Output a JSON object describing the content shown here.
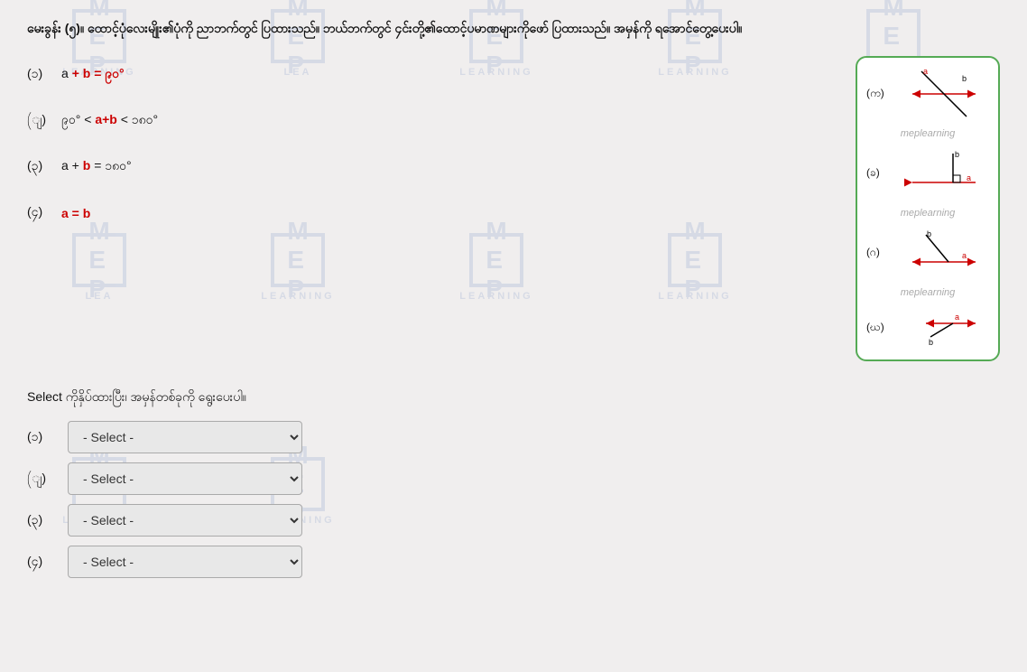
{
  "page": {
    "header": "မေးခွန်း (၅)။ ထောင့်ပုံလေးမျိုး၏ပုံကို ညာဘက်တွင် ပြထားသည်။ ဘယ်ဘက်တွင် ၄င်းတို့၏ထောင့်ပမာဏများကိုဖော် ပြထားသည်။ အမှန်ကို ရအောင်တွေ့ပေးပါ။",
    "select_instruction": "Select ကိုနှိပ်ထားပြီး၊ အမှန်တစ်ခုကို ရွေးပေးပါ။",
    "questions": [
      {
        "label": "(၁)",
        "formula": "a + b = ၉၀°"
      },
      {
        "label": "(ျ)",
        "formula": "၉၀° < a+b < ၁၈၀°"
      },
      {
        "label": "(၃)",
        "formula": "a + b = ၁၈၀°"
      },
      {
        "label": "(၄)",
        "formula": "a = b"
      }
    ],
    "diagrams": [
      {
        "label": "(က)",
        "type": "cross"
      },
      {
        "label": "(ခ)",
        "type": "right_angle"
      },
      {
        "label": "(ဂ)",
        "type": "obtuse"
      },
      {
        "label": "(ဃ)",
        "type": "parallel"
      }
    ],
    "dropdowns": [
      {
        "label": "(၁)",
        "placeholder": "- Select -"
      },
      {
        "label": "(ျ)",
        "placeholder": "- Select -"
      },
      {
        "label": "(၃)",
        "placeholder": "- Select -"
      },
      {
        "label": "(၄)",
        "placeholder": "- Select -"
      }
    ],
    "select_label": "- Select -"
  }
}
